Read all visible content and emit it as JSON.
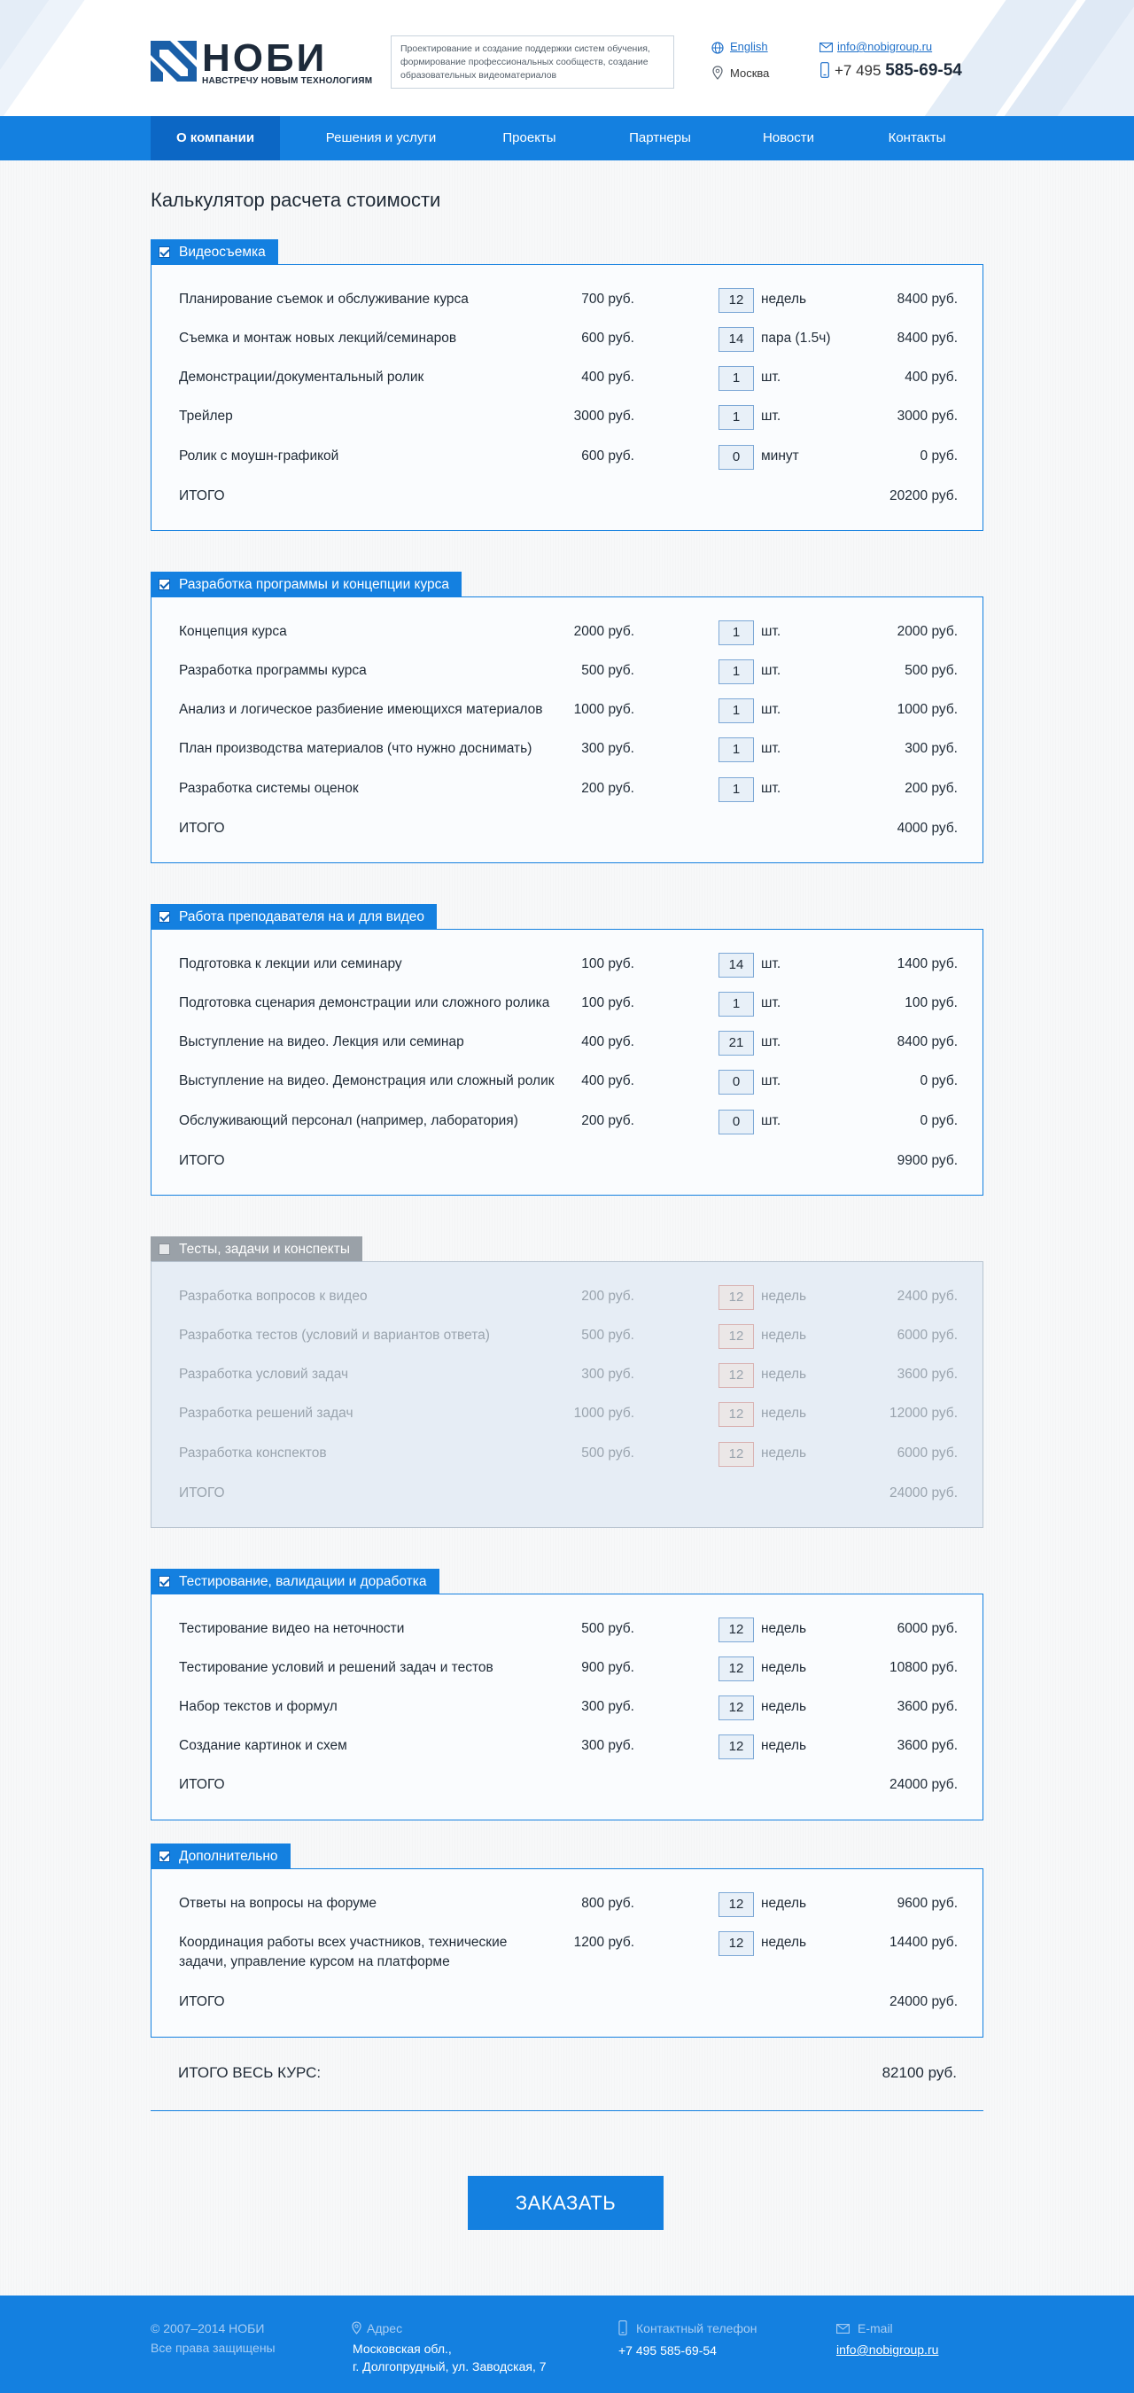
{
  "header": {
    "logo_text": "НОБИ",
    "logo_tagline": "НАВСТРЕЧУ НОВЫМ ТЕХНОЛОГИЯМ",
    "description": "Проектирование и создание поддержки систем обучения, формирование профессиональных сообществ, создание образовательных видеоматериалов",
    "language_link": "English",
    "city": "Москва",
    "email": "info@nobigroup.ru",
    "phone_prefix": "+7 495",
    "phone_number": "585-69-54"
  },
  "nav": {
    "items": [
      "О компании",
      "Решения и услуги",
      "Проекты",
      "Партнеры",
      "Новости",
      "Контакты"
    ],
    "active": "О компании"
  },
  "page_title": "Калькулятор расчета стоимости",
  "sections": [
    {
      "title": "Видеосъемка",
      "enabled": true,
      "rows": [
        {
          "name": "Планирование съемок и обслуживание курса",
          "price": "700 руб.",
          "qty": "12",
          "unit": "недель",
          "total": "8400 руб."
        },
        {
          "name": "Съемка и монтаж новых лекций/семинаров",
          "price": "600 руб.",
          "qty": "14",
          "unit": "пара (1.5ч)",
          "total": "8400 руб."
        },
        {
          "name": "Демонстрации/документальный ролик",
          "price": "400 руб.",
          "qty": "1",
          "unit": "шт.",
          "total": "400 руб."
        },
        {
          "name": "Трейлер",
          "price": "3000 руб.",
          "qty": "1",
          "unit": "шт.",
          "total": "3000 руб."
        },
        {
          "name": "Ролик с моушн-графикой",
          "price": "600 руб.",
          "qty": "0",
          "unit": "минут",
          "total": "0 руб."
        }
      ],
      "total_label": "ИТОГО",
      "total": "20200 руб."
    },
    {
      "title": "Разработка программы и концепции курса",
      "enabled": true,
      "rows": [
        {
          "name": "Концепция курса",
          "price": "2000 руб.",
          "qty": "1",
          "unit": "шт.",
          "total": "2000 руб."
        },
        {
          "name": "Разработка программы курса",
          "price": "500 руб.",
          "qty": "1",
          "unit": "шт.",
          "total": "500 руб."
        },
        {
          "name": "Анализ и логическое разбиение имеющихся материалов",
          "price": "1000 руб.",
          "qty": "1",
          "unit": "шт.",
          "total": "1000 руб."
        },
        {
          "name": "План производства материалов (что нужно доснимать)",
          "price": "300 руб.",
          "qty": "1",
          "unit": "шт.",
          "total": "300 руб."
        },
        {
          "name": "Разработка системы оценок",
          "price": "200 руб.",
          "qty": "1",
          "unit": "шт.",
          "total": "200 руб."
        }
      ],
      "total_label": "ИТОГО",
      "total": "4000 руб."
    },
    {
      "title": "Работа преподавателя на и для видео",
      "enabled": true,
      "rows": [
        {
          "name": "Подготовка к лекции или семинару",
          "price": "100 руб.",
          "qty": "14",
          "unit": "шт.",
          "total": "1400 руб."
        },
        {
          "name": "Подготовка сценария демонстрации или сложного ролика",
          "price": "100 руб.",
          "qty": "1",
          "unit": "шт.",
          "total": "100 руб."
        },
        {
          "name": "Выступление на видео. Лекция или семинар",
          "price": "400 руб.",
          "qty": "21",
          "unit": "шт.",
          "total": "8400 руб."
        },
        {
          "name": "Выступление на видео. Демонстрация или сложный ролик",
          "price": "400 руб.",
          "qty": "0",
          "unit": "шт.",
          "total": "0 руб."
        },
        {
          "name": "Обслуживающий персонал (например, лаборатория)",
          "price": "200 руб.",
          "qty": "0",
          "unit": "шт.",
          "total": "0 руб."
        }
      ],
      "total_label": "ИТОГО",
      "total": "9900 руб."
    },
    {
      "title": "Тесты, задачи и конспекты",
      "enabled": false,
      "rows": [
        {
          "name": "Разработка вопросов к видео",
          "price": "200 руб.",
          "qty": "12",
          "unit": "недель",
          "total": "2400 руб."
        },
        {
          "name": "Разработка тестов (условий и вариантов ответа)",
          "price": "500 руб.",
          "qty": "12",
          "unit": "недель",
          "total": "6000 руб."
        },
        {
          "name": "Разработка условий задач",
          "price": "300 руб.",
          "qty": "12",
          "unit": "недель",
          "total": "3600 руб."
        },
        {
          "name": "Разработка решений задач",
          "price": "1000 руб.",
          "qty": "12",
          "unit": "недель",
          "total": "12000 руб."
        },
        {
          "name": "Разработка конспектов",
          "price": "500 руб.",
          "qty": "12",
          "unit": "недель",
          "total": "6000 руб."
        }
      ],
      "total_label": "ИТОГО",
      "total": "24000 руб."
    },
    {
      "title": "Тестирование, валидации и доработка",
      "enabled": true,
      "rows": [
        {
          "name": "Тестирование видео на неточности",
          "price": "500 руб.",
          "qty": "12",
          "unit": "недель",
          "total": "6000 руб."
        },
        {
          "name": "Тестирование условий и решений задач и тестов",
          "price": "900 руб.",
          "qty": "12",
          "unit": "недель",
          "total": "10800 руб."
        },
        {
          "name": "Набор текстов и формул",
          "price": "300 руб.",
          "qty": "12",
          "unit": "недель",
          "total": "3600 руб."
        },
        {
          "name": "Создание картинок и схем",
          "price": "300 руб.",
          "qty": "12",
          "unit": "недель",
          "total": "3600 руб."
        }
      ],
      "total_label": "ИТОГО",
      "total": "24000 руб."
    },
    {
      "title": "Дополнительно",
      "enabled": true,
      "rows": [
        {
          "name": "Ответы на вопросы на форуме",
          "price": "800 руб.",
          "qty": "12",
          "unit": "недель",
          "total": "9600 руб."
        },
        {
          "name": "Координация работы всех участников, технические",
          "name2": "задачи, управление курсом на платформе",
          "price": "1200 руб.",
          "qty": "12",
          "unit": "недель",
          "total": "14400 руб."
        }
      ],
      "total_label": "ИТОГО",
      "total": "24000 руб."
    }
  ],
  "grand_total": {
    "label": "ИТОГО ВЕСЬ КУРС:",
    "value": "82100 руб."
  },
  "order_button": "ЗАКАЗАТЬ",
  "footer": {
    "copyright": "© 2007–2014 НОБИ",
    "rights": "Все права защищены",
    "address_label": "Адрес",
    "address_line1": "Московская обл.,",
    "address_line2": "г. Долгопрудный, ул. Заводская, 7",
    "phone_label": "Контактный телефон",
    "phone": "+7 495 585-69-54",
    "email_label": "E-mail",
    "email": "info@nobigroup.ru"
  },
  "colors": {
    "accent": "#1480e0",
    "nav_active": "#0c67c5",
    "disabled": "#9aa1a8",
    "footer_dim": "#a9cdf3"
  }
}
